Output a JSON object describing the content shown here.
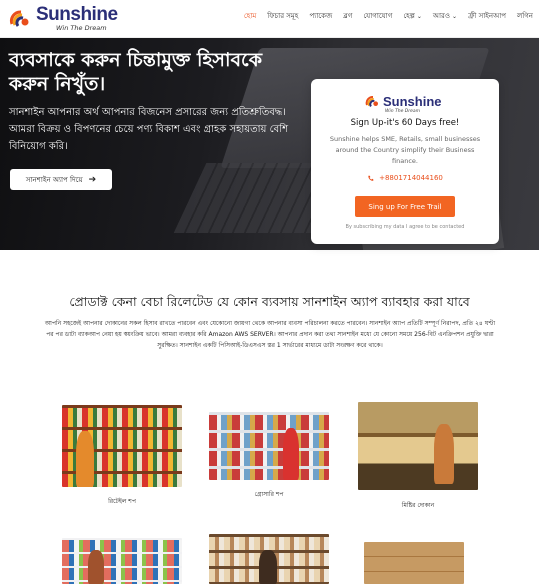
{
  "header": {
    "logo_name": "Sunshine",
    "logo_tagline": "Win The Dream",
    "nav": [
      {
        "label": "হোম",
        "active": true,
        "has_caret": false
      },
      {
        "label": "ফিচার সমূহ",
        "active": false,
        "has_caret": false
      },
      {
        "label": "প্যাকেজ",
        "active": false,
        "has_caret": false
      },
      {
        "label": "ব্লগ",
        "active": false,
        "has_caret": false
      },
      {
        "label": "যোগাযোগ",
        "active": false,
        "has_caret": false
      },
      {
        "label": "হেল্প",
        "active": false,
        "has_caret": true
      },
      {
        "label": "আরও",
        "active": false,
        "has_caret": true
      },
      {
        "label": "ফ্রী সাইনআপ",
        "active": false,
        "has_caret": false
      },
      {
        "label": "লগিন",
        "active": false,
        "has_caret": false
      }
    ]
  },
  "hero": {
    "title": "ব্যবসাকে করুন চিন্তামুক্ত হিসাবকে করুন নিখুঁত।",
    "subtitle": "সানশাইন আপনার অর্থ আপনার বিজনেস প্রসারের জন্য প্রতিশ্রুতিবদ্ধ। আমরা বিক্রয় ও বিপণনের চেয়ে পণ্য বিকাশ এবং গ্রাহক সহায়তায় বেশি বিনিয়োগ করি।",
    "button_label": "সানশাইন অ্যাপ দিয়ে",
    "button_icon": "arrow-right-icon"
  },
  "signup_card": {
    "logo_name": "Sunshine",
    "logo_tagline": "Win The Dream",
    "title": "Sign Up-it's 60 Days free!",
    "description": "Sunshine helps SME, Retails, small businesses around the Country simplify their Business finance.",
    "phone": "+8801714044160",
    "button_label": "Sing up For Free Trail",
    "note": "By subscribing my data I agree to be contacted"
  },
  "section": {
    "title": "প্রোডাক্ট কেনা বেচা রিলেটেড যে কোন ব্যবসায় সানশাইন অ্যাপ ব্যাবহার করা যাবে",
    "body": "আপনি সহজেই আপনার দোকানের সকল হিসাব রাখতে পারবেন এবং যেকোনো জায়গা থেকে আপনার ব্যবসা পরিচালনা করতে পারবেন। সানশাইন অ্যাপ প্রতিটি সম্পূর্ণ নিরাপদ, প্রতি ২৪ ঘণ্টা পর পর ডাটা ব্যাকআপ নেয়া হয় স্বয়ংক্রিয় ভাবে। আমরা ব্যবহার করি Amazon AWS SERVER। আপনার প্রদান করা তথ্য সানশাইন মধ্যে যে কোনো সময়ে 256-বিট এনক্রিপশন প্রযুক্তি দ্বারা সুরক্ষিত। সানশাইন একটি পিসিআই-ডিএসএস স্তর 1 সার্ভারের মাধ্যমে ডাটা সংরক্ষণ করে থাকে।"
  },
  "business_types": [
    {
      "label": "রিটেইল শপ"
    },
    {
      "label": "গ্রোসারি শপ"
    },
    {
      "label": "মিষ্টির দোকান"
    },
    {
      "label": ""
    },
    {
      "label": ""
    },
    {
      "label": ""
    }
  ],
  "colors": {
    "accent": "#e94e1b",
    "button_orange": "#f26522",
    "brand_navy": "#2b2f78"
  }
}
